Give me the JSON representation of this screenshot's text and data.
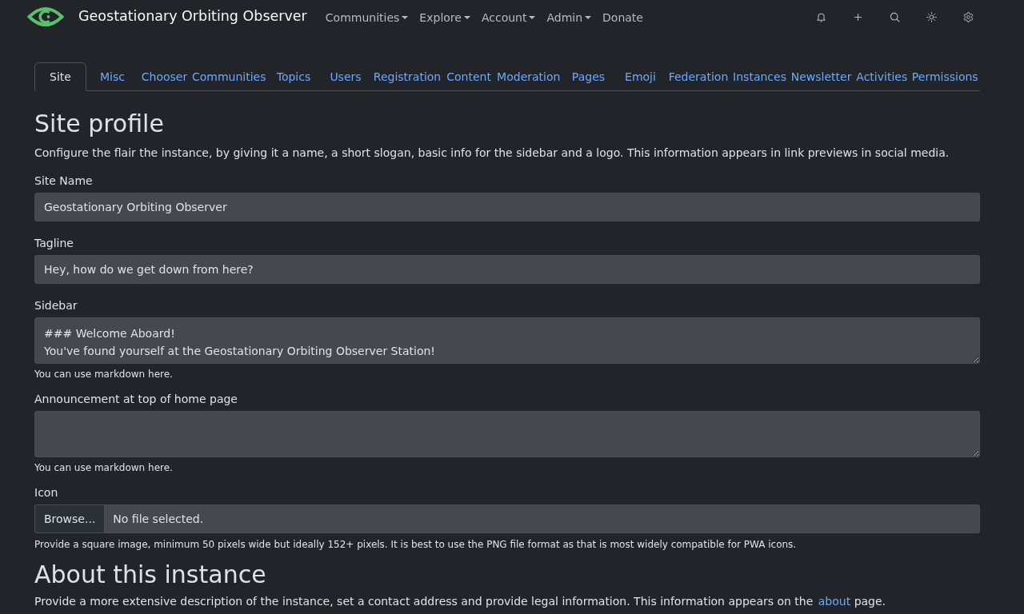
{
  "navbar": {
    "brand": "Geostationary Orbiting Observer",
    "menu": [
      {
        "label": "Communities",
        "dropdown": true
      },
      {
        "label": "Explore",
        "dropdown": true
      },
      {
        "label": "Account",
        "dropdown": true
      },
      {
        "label": "Admin",
        "dropdown": true
      },
      {
        "label": "Donate",
        "dropdown": false
      }
    ]
  },
  "tabs": [
    {
      "label": "Site",
      "selected": true
    },
    {
      "label": "Misc",
      "selected": false
    },
    {
      "label": "Chooser",
      "selected": false
    },
    {
      "label": "Communities",
      "selected": false
    },
    {
      "label": "Topics",
      "selected": false
    },
    {
      "label": "Users",
      "selected": false
    },
    {
      "label": "Registration",
      "selected": false
    },
    {
      "label": "Content",
      "selected": false
    },
    {
      "label": "Moderation",
      "selected": false
    },
    {
      "label": "Pages",
      "selected": false
    },
    {
      "label": "Emoji",
      "selected": false
    },
    {
      "label": "Federation",
      "selected": false
    },
    {
      "label": "Instances",
      "selected": false
    },
    {
      "label": "Newsletter",
      "selected": false
    },
    {
      "label": "Activities",
      "selected": false
    },
    {
      "label": "Permissions",
      "selected": false
    }
  ],
  "site_profile": {
    "title": "Site profile",
    "description": "Configure the flair the instance, by giving it a name, a short slogan, basic info for the sidebar and a logo. This information appears in link previews in social media.",
    "fields": [
      {
        "kind": "text",
        "label": "Site Name",
        "value": "Geostationary Orbiting Observer"
      },
      {
        "kind": "text",
        "label": "Tagline",
        "value": "Hey, how do we get down from here?"
      },
      {
        "kind": "textarea",
        "label": "Sidebar",
        "value_lines": [
          "### Welcome Aboard!",
          "You've found yourself at the Geostationary Orbiting Observer Station!"
        ],
        "help": "You can use markdown here."
      },
      {
        "kind": "textarea",
        "label": "Announcement at top of home page",
        "help": "You can use markdown here."
      },
      {
        "kind": "file",
        "label": "Icon",
        "button": "Browse...",
        "status": "No file selected.",
        "help": "Provide a square image, minimum 50 pixels wide but ideally 152+ pixels. It is best to use the PNG file format as that is most widely compatible for PWA icons."
      }
    ]
  },
  "about": {
    "title": "About this instance",
    "description": "Provide a more extensive description of the instance, set a contact address and provide legal information. This information appears on the",
    "link": "about",
    "description_end": "page."
  }
}
